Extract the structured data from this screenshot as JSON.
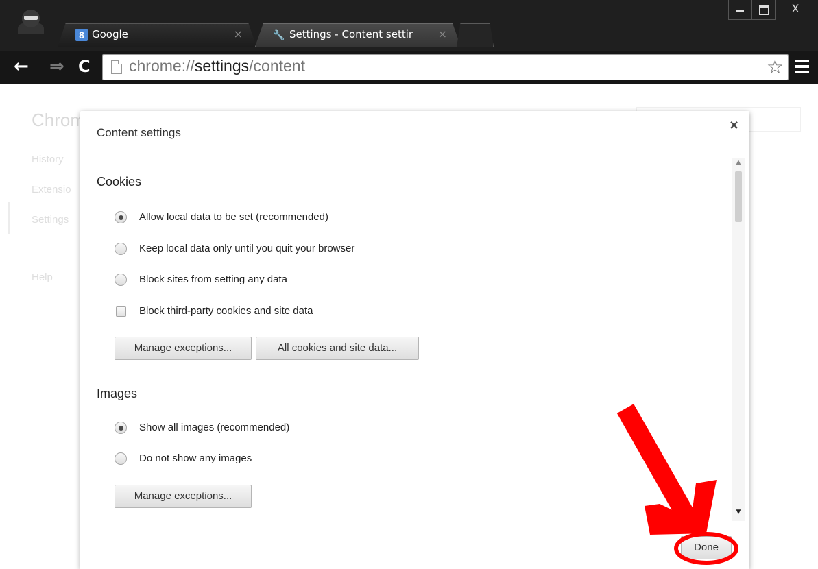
{
  "browser": {
    "tabs": [
      {
        "label": "Google",
        "icon": "google-icon"
      },
      {
        "label": "Settings - Content settings",
        "icon": "wrench-icon"
      }
    ],
    "tab_close": "×",
    "address_scheme": "chrome://",
    "address_host": "settings",
    "address_path": "/content",
    "window_close": "X"
  },
  "background_page": {
    "title": "Chrom",
    "nav": [
      "History",
      "Extensio",
      "Settings",
      "Help"
    ]
  },
  "dialog": {
    "title": "Content settings",
    "close": "×",
    "cookies": {
      "heading": "Cookies",
      "options": [
        {
          "label": "Allow local data to be set (recommended)",
          "selected": true
        },
        {
          "label": "Keep local data only until you quit your browser",
          "selected": false
        },
        {
          "label": "Block sites from setting any data",
          "selected": false
        }
      ],
      "checkbox_label": "Block third-party cookies and site data",
      "checkbox_checked": false,
      "manage_button": "Manage exceptions...",
      "all_cookies_button": "All cookies and site data..."
    },
    "images": {
      "heading": "Images",
      "options": [
        {
          "label": "Show all images (recommended)",
          "selected": true
        },
        {
          "label": "Do not show any images",
          "selected": false
        }
      ],
      "manage_button": "Manage exceptions..."
    },
    "done_button": "Done"
  },
  "annotation": {
    "color": "#ff0000",
    "shape": "arrow pointing to Done button with circle"
  }
}
